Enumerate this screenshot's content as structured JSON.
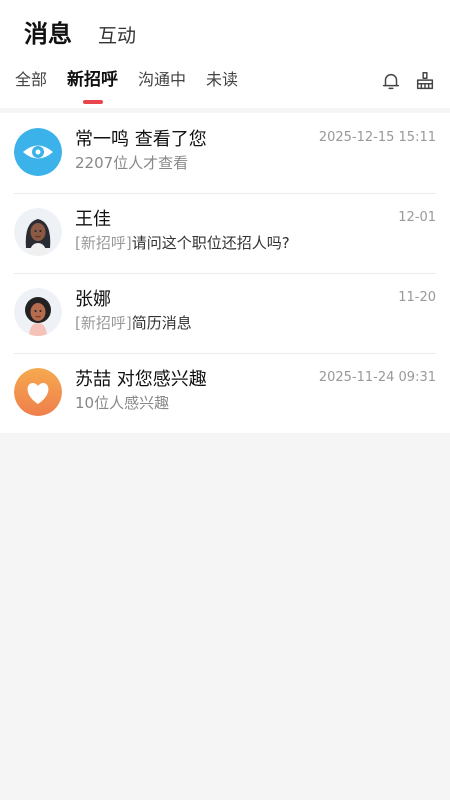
{
  "header": {
    "top_tabs": [
      {
        "label": "消息",
        "active": true
      },
      {
        "label": "互动",
        "active": false
      }
    ],
    "sub_tabs": [
      {
        "label": "全部",
        "active": false
      },
      {
        "label": "新招呼",
        "active": true
      },
      {
        "label": "沟通中",
        "active": false
      },
      {
        "label": "未读",
        "active": false
      }
    ],
    "icons": [
      "bell-icon",
      "sweep-icon"
    ]
  },
  "colors": {
    "accent": "#e8454c",
    "eye_avatar": "#3cb2ea",
    "heart_avatar": "#f29a4a"
  },
  "messages": [
    {
      "name": "常一鸣 查看了您",
      "preview": "2207位人才查看",
      "time": "2025-12-15 15:11",
      "avatar": "eye-icon"
    },
    {
      "name": "王佳",
      "tag": "[新招呼]",
      "preview": "请问这个职位还招人吗?",
      "time": "12-01",
      "avatar": "user-avatar"
    },
    {
      "name": "张娜",
      "tag": "[新招呼]",
      "preview": "简历消息",
      "time": "11-20",
      "avatar": "user-avatar"
    },
    {
      "name": "苏喆 对您感兴趣",
      "preview": "10位人感兴趣",
      "time": "2025-11-24 09:31",
      "avatar": "heart-icon"
    }
  ]
}
